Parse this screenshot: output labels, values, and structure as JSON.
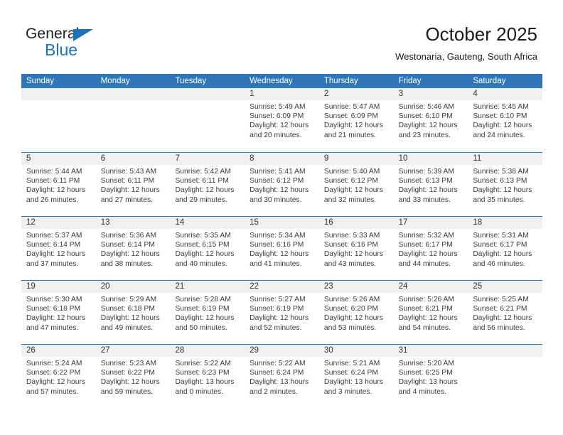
{
  "brand": {
    "name_top": "General",
    "name_bottom": "Blue",
    "accent_color": "#1b72b8"
  },
  "header": {
    "title": "October 2025",
    "location": "Westonaria, Gauteng, South Africa"
  },
  "calendar": {
    "header_color": "#2e76b8",
    "day_band_color": "#f0f0f0",
    "weekdays": [
      "Sunday",
      "Monday",
      "Tuesday",
      "Wednesday",
      "Thursday",
      "Friday",
      "Saturday"
    ],
    "weeks": [
      [
        {
          "day": "",
          "empty": true
        },
        {
          "day": "",
          "empty": true
        },
        {
          "day": "",
          "empty": true
        },
        {
          "day": "1",
          "sunrise": "Sunrise: 5:49 AM",
          "sunset": "Sunset: 6:09 PM",
          "daylight_1": "Daylight: 12 hours",
          "daylight_2": "and 20 minutes."
        },
        {
          "day": "2",
          "sunrise": "Sunrise: 5:47 AM",
          "sunset": "Sunset: 6:09 PM",
          "daylight_1": "Daylight: 12 hours",
          "daylight_2": "and 21 minutes."
        },
        {
          "day": "3",
          "sunrise": "Sunrise: 5:46 AM",
          "sunset": "Sunset: 6:10 PM",
          "daylight_1": "Daylight: 12 hours",
          "daylight_2": "and 23 minutes."
        },
        {
          "day": "4",
          "sunrise": "Sunrise: 5:45 AM",
          "sunset": "Sunset: 6:10 PM",
          "daylight_1": "Daylight: 12 hours",
          "daylight_2": "and 24 minutes."
        }
      ],
      [
        {
          "day": "5",
          "sunrise": "Sunrise: 5:44 AM",
          "sunset": "Sunset: 6:11 PM",
          "daylight_1": "Daylight: 12 hours",
          "daylight_2": "and 26 minutes."
        },
        {
          "day": "6",
          "sunrise": "Sunrise: 5:43 AM",
          "sunset": "Sunset: 6:11 PM",
          "daylight_1": "Daylight: 12 hours",
          "daylight_2": "and 27 minutes."
        },
        {
          "day": "7",
          "sunrise": "Sunrise: 5:42 AM",
          "sunset": "Sunset: 6:11 PM",
          "daylight_1": "Daylight: 12 hours",
          "daylight_2": "and 29 minutes."
        },
        {
          "day": "8",
          "sunrise": "Sunrise: 5:41 AM",
          "sunset": "Sunset: 6:12 PM",
          "daylight_1": "Daylight: 12 hours",
          "daylight_2": "and 30 minutes."
        },
        {
          "day": "9",
          "sunrise": "Sunrise: 5:40 AM",
          "sunset": "Sunset: 6:12 PM",
          "daylight_1": "Daylight: 12 hours",
          "daylight_2": "and 32 minutes."
        },
        {
          "day": "10",
          "sunrise": "Sunrise: 5:39 AM",
          "sunset": "Sunset: 6:13 PM",
          "daylight_1": "Daylight: 12 hours",
          "daylight_2": "and 33 minutes."
        },
        {
          "day": "11",
          "sunrise": "Sunrise: 5:38 AM",
          "sunset": "Sunset: 6:13 PM",
          "daylight_1": "Daylight: 12 hours",
          "daylight_2": "and 35 minutes."
        }
      ],
      [
        {
          "day": "12",
          "sunrise": "Sunrise: 5:37 AM",
          "sunset": "Sunset: 6:14 PM",
          "daylight_1": "Daylight: 12 hours",
          "daylight_2": "and 37 minutes."
        },
        {
          "day": "13",
          "sunrise": "Sunrise: 5:36 AM",
          "sunset": "Sunset: 6:14 PM",
          "daylight_1": "Daylight: 12 hours",
          "daylight_2": "and 38 minutes."
        },
        {
          "day": "14",
          "sunrise": "Sunrise: 5:35 AM",
          "sunset": "Sunset: 6:15 PM",
          "daylight_1": "Daylight: 12 hours",
          "daylight_2": "and 40 minutes."
        },
        {
          "day": "15",
          "sunrise": "Sunrise: 5:34 AM",
          "sunset": "Sunset: 6:16 PM",
          "daylight_1": "Daylight: 12 hours",
          "daylight_2": "and 41 minutes."
        },
        {
          "day": "16",
          "sunrise": "Sunrise: 5:33 AM",
          "sunset": "Sunset: 6:16 PM",
          "daylight_1": "Daylight: 12 hours",
          "daylight_2": "and 43 minutes."
        },
        {
          "day": "17",
          "sunrise": "Sunrise: 5:32 AM",
          "sunset": "Sunset: 6:17 PM",
          "daylight_1": "Daylight: 12 hours",
          "daylight_2": "and 44 minutes."
        },
        {
          "day": "18",
          "sunrise": "Sunrise: 5:31 AM",
          "sunset": "Sunset: 6:17 PM",
          "daylight_1": "Daylight: 12 hours",
          "daylight_2": "and 46 minutes."
        }
      ],
      [
        {
          "day": "19",
          "sunrise": "Sunrise: 5:30 AM",
          "sunset": "Sunset: 6:18 PM",
          "daylight_1": "Daylight: 12 hours",
          "daylight_2": "and 47 minutes."
        },
        {
          "day": "20",
          "sunrise": "Sunrise: 5:29 AM",
          "sunset": "Sunset: 6:18 PM",
          "daylight_1": "Daylight: 12 hours",
          "daylight_2": "and 49 minutes."
        },
        {
          "day": "21",
          "sunrise": "Sunrise: 5:28 AM",
          "sunset": "Sunset: 6:19 PM",
          "daylight_1": "Daylight: 12 hours",
          "daylight_2": "and 50 minutes."
        },
        {
          "day": "22",
          "sunrise": "Sunrise: 5:27 AM",
          "sunset": "Sunset: 6:19 PM",
          "daylight_1": "Daylight: 12 hours",
          "daylight_2": "and 52 minutes."
        },
        {
          "day": "23",
          "sunrise": "Sunrise: 5:26 AM",
          "sunset": "Sunset: 6:20 PM",
          "daylight_1": "Daylight: 12 hours",
          "daylight_2": "and 53 minutes."
        },
        {
          "day": "24",
          "sunrise": "Sunrise: 5:26 AM",
          "sunset": "Sunset: 6:21 PM",
          "daylight_1": "Daylight: 12 hours",
          "daylight_2": "and 54 minutes."
        },
        {
          "day": "25",
          "sunrise": "Sunrise: 5:25 AM",
          "sunset": "Sunset: 6:21 PM",
          "daylight_1": "Daylight: 12 hours",
          "daylight_2": "and 56 minutes."
        }
      ],
      [
        {
          "day": "26",
          "sunrise": "Sunrise: 5:24 AM",
          "sunset": "Sunset: 6:22 PM",
          "daylight_1": "Daylight: 12 hours",
          "daylight_2": "and 57 minutes."
        },
        {
          "day": "27",
          "sunrise": "Sunrise: 5:23 AM",
          "sunset": "Sunset: 6:22 PM",
          "daylight_1": "Daylight: 12 hours",
          "daylight_2": "and 59 minutes."
        },
        {
          "day": "28",
          "sunrise": "Sunrise: 5:22 AM",
          "sunset": "Sunset: 6:23 PM",
          "daylight_1": "Daylight: 13 hours",
          "daylight_2": "and 0 minutes."
        },
        {
          "day": "29",
          "sunrise": "Sunrise: 5:22 AM",
          "sunset": "Sunset: 6:24 PM",
          "daylight_1": "Daylight: 13 hours",
          "daylight_2": "and 2 minutes."
        },
        {
          "day": "30",
          "sunrise": "Sunrise: 5:21 AM",
          "sunset": "Sunset: 6:24 PM",
          "daylight_1": "Daylight: 13 hours",
          "daylight_2": "and 3 minutes."
        },
        {
          "day": "31",
          "sunrise": "Sunrise: 5:20 AM",
          "sunset": "Sunset: 6:25 PM",
          "daylight_1": "Daylight: 13 hours",
          "daylight_2": "and 4 minutes."
        },
        {
          "day": "",
          "empty": true
        }
      ]
    ]
  }
}
